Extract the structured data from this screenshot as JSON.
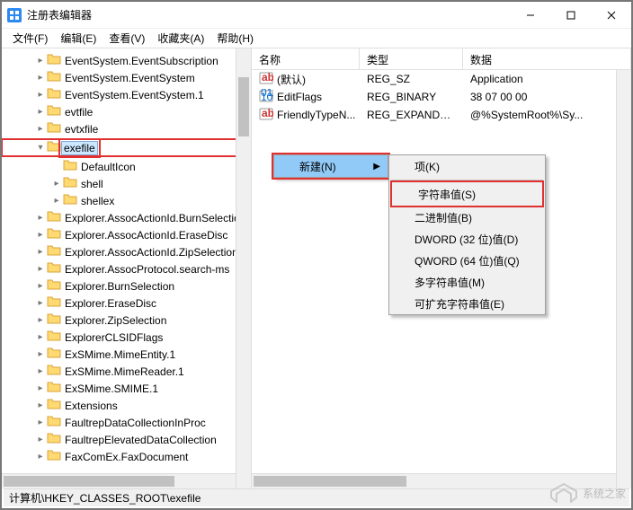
{
  "title": "注册表编辑器",
  "menus": [
    "文件(F)",
    "编辑(E)",
    "查看(V)",
    "收藏夹(A)",
    "帮助(H)"
  ],
  "tree": [
    {
      "depth": 1,
      "exp": "►",
      "label": "EventSystem.EventSubscription"
    },
    {
      "depth": 1,
      "exp": "►",
      "label": "EventSystem.EventSystem"
    },
    {
      "depth": 1,
      "exp": "►",
      "label": "EventSystem.EventSystem.1"
    },
    {
      "depth": 1,
      "exp": "►",
      "label": "evtfile"
    },
    {
      "depth": 1,
      "exp": "►",
      "label": "evtxfile"
    },
    {
      "depth": 1,
      "exp": "▼",
      "label": "exefile",
      "selected": true,
      "red": true
    },
    {
      "depth": 2,
      "exp": "",
      "label": "DefaultIcon"
    },
    {
      "depth": 2,
      "exp": "►",
      "label": "shell"
    },
    {
      "depth": 2,
      "exp": "►",
      "label": "shellex"
    },
    {
      "depth": 1,
      "exp": "►",
      "label": "Explorer.AssocActionId.BurnSelection"
    },
    {
      "depth": 1,
      "exp": "►",
      "label": "Explorer.AssocActionId.EraseDisc"
    },
    {
      "depth": 1,
      "exp": "►",
      "label": "Explorer.AssocActionId.ZipSelection"
    },
    {
      "depth": 1,
      "exp": "►",
      "label": "Explorer.AssocProtocol.search-ms"
    },
    {
      "depth": 1,
      "exp": "►",
      "label": "Explorer.BurnSelection"
    },
    {
      "depth": 1,
      "exp": "►",
      "label": "Explorer.EraseDisc"
    },
    {
      "depth": 1,
      "exp": "►",
      "label": "Explorer.ZipSelection"
    },
    {
      "depth": 1,
      "exp": "►",
      "label": "ExplorerCLSIDFlags"
    },
    {
      "depth": 1,
      "exp": "►",
      "label": "ExSMime.MimeEntity.1"
    },
    {
      "depth": 1,
      "exp": "►",
      "label": "ExSMime.MimeReader.1"
    },
    {
      "depth": 1,
      "exp": "►",
      "label": "ExSMime.SMIME.1"
    },
    {
      "depth": 1,
      "exp": "►",
      "label": "Extensions"
    },
    {
      "depth": 1,
      "exp": "►",
      "label": "FaultrepDataCollectionInProc"
    },
    {
      "depth": 1,
      "exp": "►",
      "label": "FaultrepElevatedDataCollection"
    },
    {
      "depth": 1,
      "exp": "►",
      "label": "FaxComEx.FaxDocument"
    }
  ],
  "columns": {
    "name": "名称",
    "type": "类型",
    "data": "数据"
  },
  "rows": [
    {
      "icon": "str",
      "name": "(默认)",
      "type": "REG_SZ",
      "data": "Application"
    },
    {
      "icon": "bin",
      "name": "EditFlags",
      "type": "REG_BINARY",
      "data": "38 07 00 00"
    },
    {
      "icon": "str",
      "name": "FriendlyTypeN...",
      "type": "REG_EXPAND_SZ",
      "data": "@%SystemRoot%\\Sy..."
    }
  ],
  "ctx1": {
    "label": "新建(N)",
    "red": true
  },
  "ctx2": [
    {
      "label": "项(K)"
    },
    {
      "label": "字符串值(S)",
      "red": true
    },
    {
      "label": "二进制值(B)"
    },
    {
      "label": "DWORD (32 位)值(D)"
    },
    {
      "label": "QWORD (64 位)值(Q)"
    },
    {
      "label": "多字符串值(M)"
    },
    {
      "label": "可扩充字符串值(E)"
    }
  ],
  "status": "计算机\\HKEY_CLASSES_ROOT\\exefile",
  "watermark": "系统之家"
}
